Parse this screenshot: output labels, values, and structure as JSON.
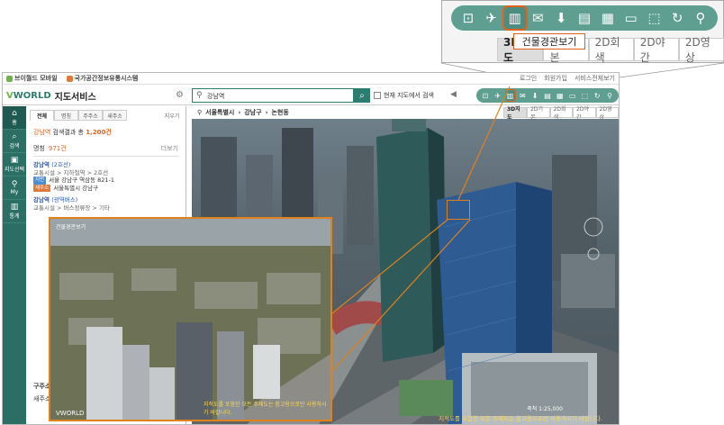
{
  "zoom": {
    "tooltip": "건물경관보기",
    "tabs": [
      "3D지도",
      "2D기본",
      "2D회색",
      "2D야간",
      "2D영상"
    ],
    "tools": [
      "measure-icon",
      "satellite-icon",
      "building-view-icon",
      "share-icon",
      "download-icon",
      "print-icon",
      "building-icon",
      "ruler-icon",
      "area-icon",
      "refresh-icon",
      "location-icon"
    ]
  },
  "topbar": {
    "left": [
      "브이월드 모바일",
      "국가공간정보유통시스템"
    ],
    "right": [
      "로그인",
      "회원가입",
      "서비스전체보기"
    ]
  },
  "header": {
    "logo": "WORLD",
    "logo_prefix": "V",
    "service": "지도서비스",
    "search_value": "강남역",
    "in_map_label": "현재 지도에서 검색"
  },
  "leftnav": [
    {
      "icon": "home-icon",
      "label": "홈"
    },
    {
      "icon": "search-icon",
      "label": "검색"
    },
    {
      "icon": "map-select-icon",
      "label": "지도선택"
    },
    {
      "icon": "my-icon",
      "label": "My"
    },
    {
      "icon": "stats-icon",
      "label": "통계"
    }
  ],
  "panel": {
    "tabs": [
      "전체",
      "명칭",
      "주주소",
      "새주소"
    ],
    "more_tab": "지우기",
    "result_keyword": "강남역",
    "result_text": " 검색결과 총 ",
    "result_count": "1,200건",
    "sub_title": "명칭",
    "sub_count": "971건",
    "sub_more": "더보기",
    "items": [
      {
        "name": "강남역",
        "name_sub": "(2호선)",
        "category": "교통시설 > 지하철역 > 2호선",
        "addr1_tag": "지번",
        "addr1": "서울 강남구 역삼동 821-1",
        "addr2_tag": "새주소",
        "addr2": "서울특별시 강남구"
      },
      {
        "name": "강남역",
        "name_sub": "(광역버스)",
        "category": "교통시설 > 버스정류장 > 기타"
      }
    ],
    "bottom1": "구주소",
    "bottom2": "새주소"
  },
  "crumb": [
    "서울특별시",
    "강남구",
    "논현동"
  ],
  "maptabs": [
    "3D지도",
    "2D기본",
    "2D회색",
    "2D야간",
    "2D영상"
  ],
  "map": {
    "note": "지적도를 포함한 모든 주제도는 참고용으로만 사용하시기 바랍니다.",
    "scale": "축척 1:25,000"
  },
  "inset": {
    "caption": "건물경관보기",
    "logo": "VWORLD",
    "note": "지적도를 포함한 모든 주제도는 참고용으로만 사용하시기 바랍니다."
  }
}
